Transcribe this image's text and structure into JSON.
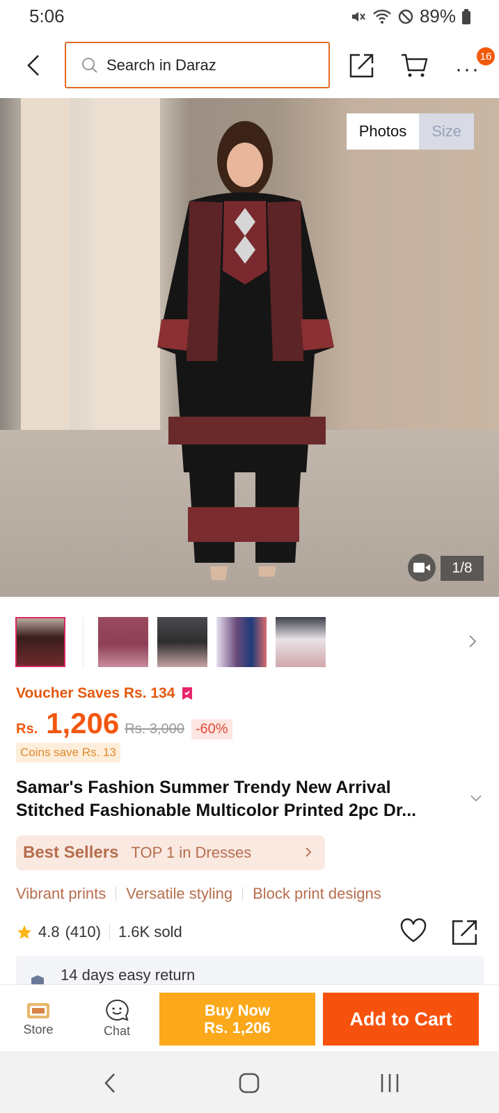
{
  "status_bar": {
    "time": "5:06",
    "battery": "89%",
    "icons": [
      "mute-icon",
      "wifi-icon",
      "dnd-icon",
      "battery-icon"
    ]
  },
  "header": {
    "search_placeholder": "Search in Daraz",
    "cart_badge": "16",
    "more_label": "···"
  },
  "gallery": {
    "toggle_photos": "Photos",
    "toggle_size": "Size",
    "counter": "1/8",
    "thumbnail_count": 5
  },
  "price": {
    "voucher": "Voucher Saves Rs. 134",
    "currency": "Rs.",
    "current": "1,206",
    "original": "Rs. 3,000",
    "discount": "-60%",
    "coins": "Coins save Rs. 13"
  },
  "product": {
    "title_line1": "Samar's Fashion Summer Trendy New Arrival",
    "title_line2": "Stitched Fashionable Multicolor Printed 2pc Dr..."
  },
  "best_sellers": {
    "label": "Best Sellers",
    "rank": "TOP 1 in Dresses"
  },
  "tags": [
    "Vibrant prints",
    "Versatile styling",
    "Block print designs"
  ],
  "rating": {
    "score": "4.8",
    "count": "(410)",
    "sold": "1.6K sold"
  },
  "return_policy": "14 days easy return",
  "bottom_bar": {
    "store_label": "Store",
    "chat_label": "Chat",
    "buy_now_line1": "Buy Now",
    "buy_now_line2": "Rs. 1,206",
    "add_to_cart": "Add to Cart"
  },
  "colors": {
    "accent_orange": "#f2570d",
    "buy_now": "#fba81b",
    "add_to_cart": "#f7520d",
    "best_sellers_bg": "#f9e9e1"
  }
}
